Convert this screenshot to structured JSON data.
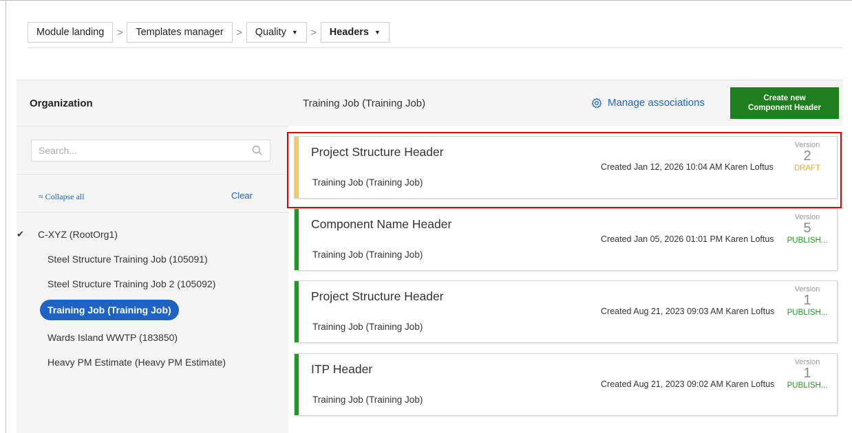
{
  "breadcrumb": {
    "items": [
      {
        "label": "Module landing"
      },
      {
        "label": "Templates manager"
      },
      {
        "label": "Quality"
      },
      {
        "label": "Headers"
      }
    ],
    "separator": ">"
  },
  "left_panel": {
    "title": "Organization",
    "search_placeholder": "Search...",
    "collapse_label": "≈ Collapse all",
    "clear_label": "Clear",
    "tree": {
      "root": "C-XYZ (RootOrg1)",
      "children": [
        "Steel Structure Training Job (105091)",
        "Steel Structure Training Job 2 (105092)",
        "Training Job (Training Job)",
        "Wards Island WWTP (183850)",
        "Heavy PM Estimate (Heavy PM Estimate)"
      ],
      "selected_index": 2
    }
  },
  "right_panel": {
    "title": "Training Job (Training Job)",
    "manage_label": "Manage associations",
    "create_label_line1": "Create new",
    "create_label_line2": "Component Header",
    "version_label": "Version",
    "cards": [
      {
        "title": "Project Structure Header",
        "subtitle": "Training Job (Training Job)",
        "meta": "Created Jan 12, 2026 10:04 AM Karen Loftus",
        "version": "2",
        "status": "DRAFT",
        "status_color": "#f5a623",
        "bar_color": "#f8c66a",
        "highlighted": true
      },
      {
        "title": "Component Name Header",
        "subtitle": "Training Job (Training Job)",
        "meta": "Created Jan 05, 2026 01:01 PM Karen Loftus",
        "version": "5",
        "status": "PUBLISH...",
        "status_color": "#1f9a1f",
        "bar_color": "#1f9a1f",
        "highlighted": false
      },
      {
        "title": "Project Structure Header",
        "subtitle": "Training Job (Training Job)",
        "meta": "Created Aug 21, 2023 09:03 AM Karen Loftus",
        "version": "1",
        "status": "PUBLISH...",
        "status_color": "#1f9a1f",
        "bar_color": "#1f9a1f",
        "highlighted": false
      },
      {
        "title": "ITP Header",
        "subtitle": "Training Job (Training Job)",
        "meta": "Created Aug 21, 2023 09:02 AM Karen Loftus",
        "version": "1",
        "status": "PUBLISH...",
        "status_color": "#1f9a1f",
        "bar_color": "#1f9a1f",
        "highlighted": false
      }
    ]
  },
  "colors": {
    "accent_blue": "#1e63c4",
    "create_green": "#1f7f1f",
    "highlight_red": "#e00000"
  }
}
